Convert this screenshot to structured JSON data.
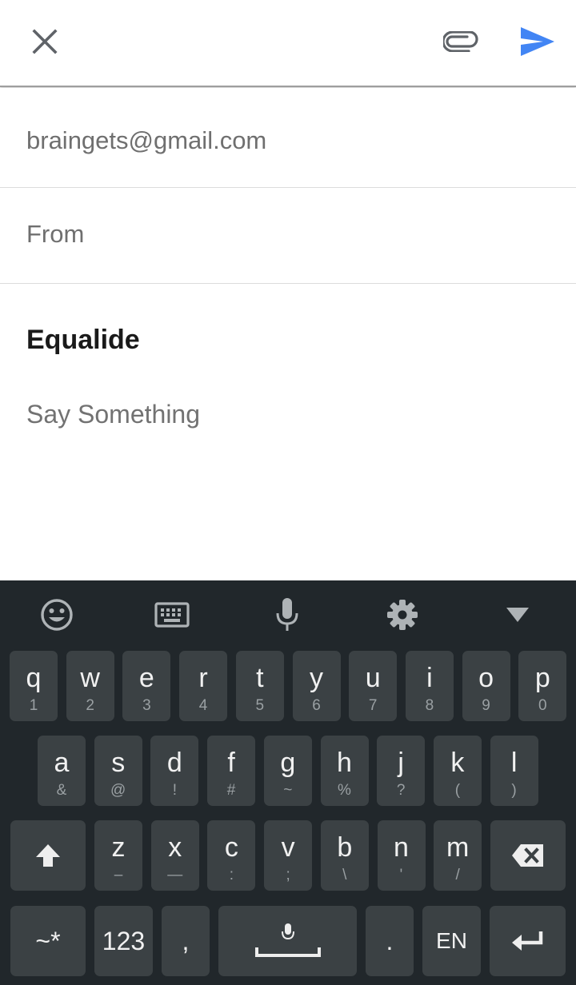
{
  "header": {
    "close_icon": "close-icon",
    "attach_icon": "paperclip-icon",
    "send_icon": "send-icon",
    "send_color": "#4285f4"
  },
  "compose": {
    "to": "braingets@gmail.com",
    "from_label": "From",
    "subject": "Equalide",
    "body_placeholder": "Say Something"
  },
  "keyboard": {
    "toolbar": [
      "emoji-icon",
      "keyboard-icon",
      "microphone-icon",
      "settings-gear-icon",
      "collapse-triangle-icon"
    ],
    "row1": [
      {
        "main": "q",
        "sub": "1"
      },
      {
        "main": "w",
        "sub": "2"
      },
      {
        "main": "e",
        "sub": "3"
      },
      {
        "main": "r",
        "sub": "4"
      },
      {
        "main": "t",
        "sub": "5"
      },
      {
        "main": "y",
        "sub": "6"
      },
      {
        "main": "u",
        "sub": "7"
      },
      {
        "main": "i",
        "sub": "8"
      },
      {
        "main": "o",
        "sub": "9"
      },
      {
        "main": "p",
        "sub": "0"
      }
    ],
    "row2": [
      {
        "main": "a",
        "sub": "&"
      },
      {
        "main": "s",
        "sub": "@"
      },
      {
        "main": "d",
        "sub": "!"
      },
      {
        "main": "f",
        "sub": "#"
      },
      {
        "main": "g",
        "sub": "~"
      },
      {
        "main": "h",
        "sub": "%"
      },
      {
        "main": "j",
        "sub": "?"
      },
      {
        "main": "k",
        "sub": "("
      },
      {
        "main": "l",
        "sub": ")"
      }
    ],
    "row3": [
      {
        "main": "z",
        "sub": "–"
      },
      {
        "main": "x",
        "sub": "—"
      },
      {
        "main": "c",
        "sub": ":"
      },
      {
        "main": "v",
        "sub": ";"
      },
      {
        "main": "b",
        "sub": "\\"
      },
      {
        "main": "n",
        "sub": "'"
      },
      {
        "main": "m",
        "sub": "/"
      }
    ],
    "symbols_label": "~*",
    "numbers_label": "123",
    "comma_label": ",",
    "period_label": ".",
    "language_label": "EN"
  }
}
